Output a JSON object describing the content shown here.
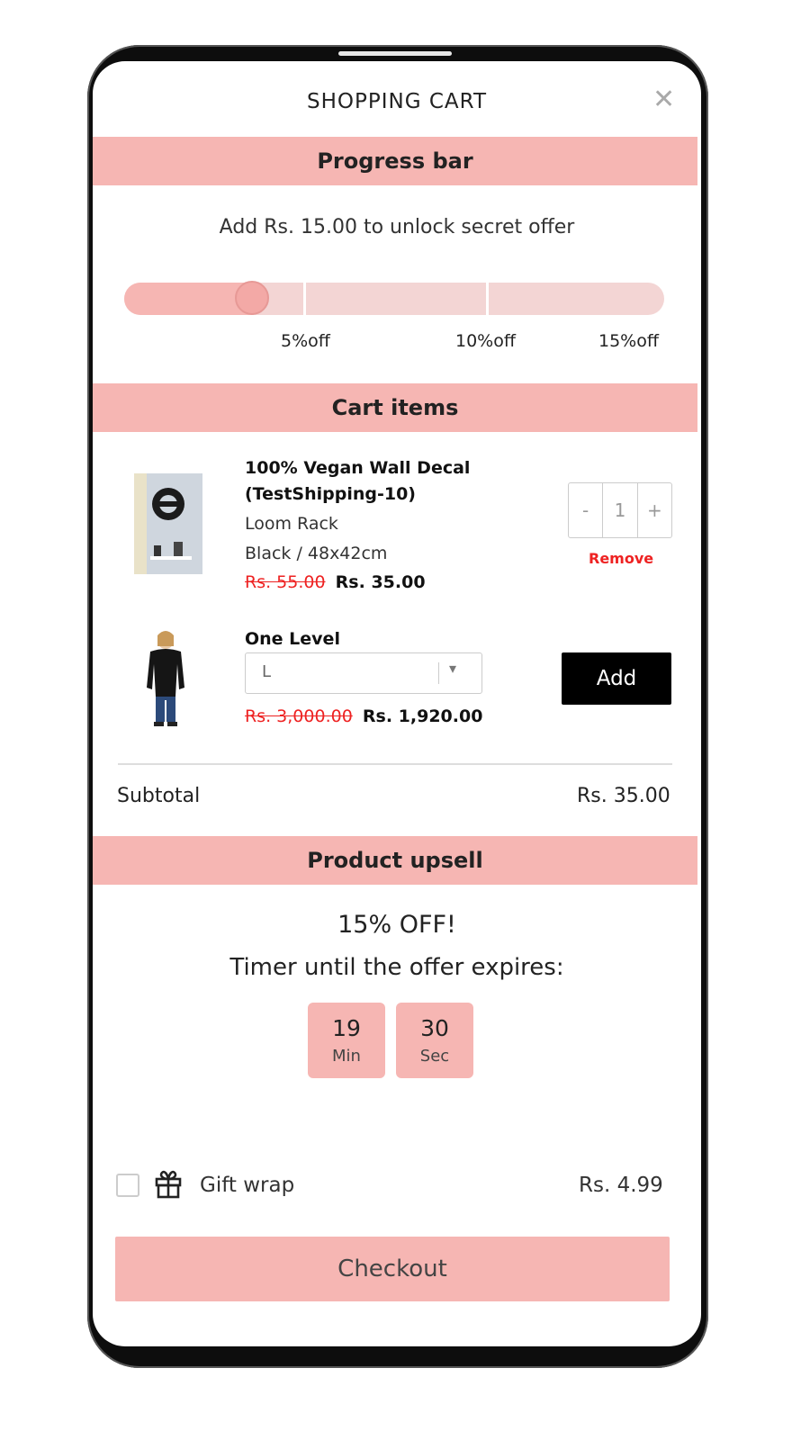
{
  "header": {
    "title": "SHOPPING CART",
    "close_icon": "close-icon"
  },
  "sections": {
    "progress": "Progress bar",
    "cart_items": "Cart items",
    "upsell": "Product upsell"
  },
  "progress": {
    "message": "Add Rs. 15.00 to unlock secret offer",
    "value_fraction": 0.24,
    "milestones": [
      "5%off",
      "10%off",
      "15%off"
    ]
  },
  "cart": {
    "items": [
      {
        "name_line1": "100% Vegan Wall Decal",
        "name_line2": "(TestShipping-10)",
        "vendor": "Loom Rack",
        "variant": "Black / 48x42cm",
        "compare_price": "Rs. 55.00",
        "price": "Rs. 35.00",
        "quantity": "1",
        "qty_minus": "-",
        "qty_plus": "+",
        "remove": "Remove"
      }
    ],
    "recommendation": {
      "name": "One Level",
      "selected_option": "L",
      "compare_price": "Rs. 3,000.00",
      "price": "Rs. 1,920.00",
      "add_label": "Add"
    },
    "subtotal_label": "Subtotal",
    "subtotal_value": "Rs. 35.00"
  },
  "upsell": {
    "offer": "15% OFF!",
    "timer_label": "Timer until the offer expires:",
    "minutes": "19",
    "minutes_unit": "Min",
    "seconds": "30",
    "seconds_unit": "Sec"
  },
  "gift_wrap": {
    "label": "Gift wrap",
    "price": "Rs. 4.99",
    "icon": "gift-icon"
  },
  "checkout": {
    "label": "Checkout"
  },
  "colors": {
    "accent": "#f6b6b3",
    "track": "#f3d5d4",
    "remove": "#ee2222",
    "add_button": "#000000"
  }
}
